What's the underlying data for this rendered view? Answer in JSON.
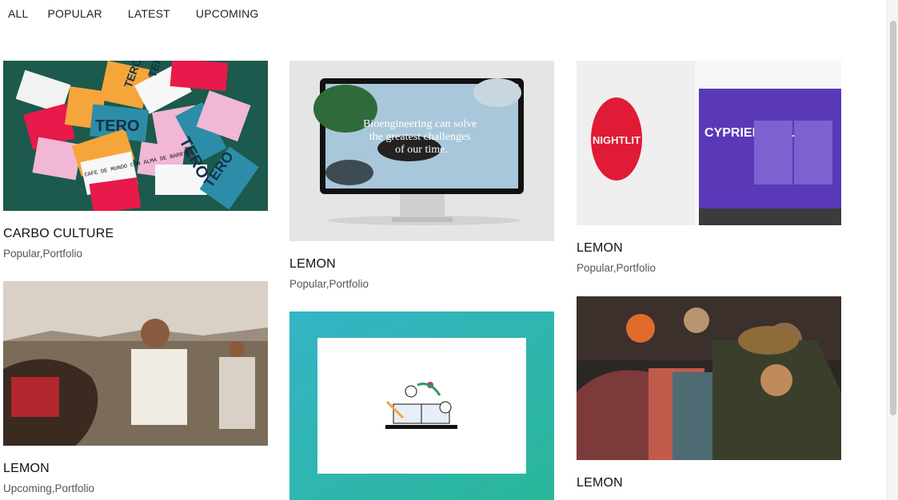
{
  "filters": [
    "ALL",
    "POPULAR",
    "LATEST",
    "UPCOMING"
  ],
  "cards": [
    {
      "title": "CARBO CULTURE",
      "tags": "Popular,Portfolio",
      "image": "tero-cards-photo"
    },
    {
      "title": "LEMON",
      "tags": "Popular,Portfolio",
      "image": "monitor-mockup",
      "screen_text": "Bioengineering can solve the greatest challenges of our time."
    },
    {
      "title": "LEMON",
      "tags": "Popular,Portfolio",
      "image": "gallery-wall-photo",
      "wall_text": "CYPRIEN GAILLARD",
      "sphere_text": "NIGHTLIT"
    },
    {
      "title": "LEMON",
      "tags": "Upcoming,Portfolio",
      "image": "horse-man-photo"
    },
    {
      "title": "",
      "tags": "",
      "image": "books-flowers-illustration"
    },
    {
      "title": "LEMON",
      "tags": "",
      "image": "festival-crowd-photo"
    }
  ],
  "tero_labels": [
    "TERO",
    "TERO",
    "TERO",
    "TERO",
    "TERO",
    "CAFE DE MUNDO CON ALMA DE BARRIO"
  ],
  "colors": {
    "accent_teal": "#2fb9b5",
    "purple_wall": "#5a39b8",
    "tero_green": "#1b5a4c"
  }
}
